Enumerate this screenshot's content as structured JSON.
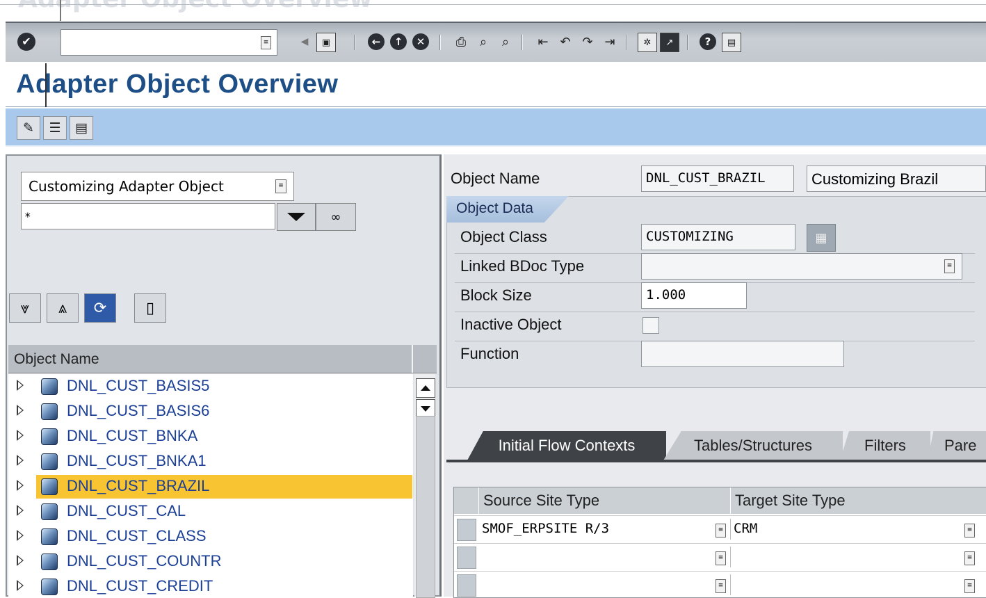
{
  "window": {
    "ghost_title": "Adapter Object Overview"
  },
  "toolbar": {
    "command_value": "",
    "icons": [
      "enter-icon",
      "save-icon",
      "back-icon",
      "exit-icon",
      "cancel-icon",
      "print-icon",
      "find-icon",
      "find-next-icon",
      "first-page-icon",
      "previous-page-icon",
      "next-page-icon",
      "last-page-icon",
      "create-session-icon",
      "shortcut-icon",
      "help-icon",
      "layout-menu-icon"
    ]
  },
  "title": {
    "text": "Adapter Object Overview"
  },
  "app_toolbar": {
    "buttons": [
      "edit-icon",
      "print-list-icon",
      "display-list-icon"
    ]
  },
  "left_panel": {
    "selector_label": "Customizing Adapter Object",
    "pattern_value": "*",
    "tree_toolbar": [
      "expand-all-icon",
      "collapse-all-icon",
      "refresh-icon",
      "new-object-icon"
    ],
    "column_header": "Object Name",
    "items": [
      {
        "label": "DNL_CUST_BASIS5"
      },
      {
        "label": "DNL_CUST_BASIS6"
      },
      {
        "label": "DNL_CUST_BNKA"
      },
      {
        "label": "DNL_CUST_BNKA1"
      },
      {
        "label": "DNL_CUST_BRAZIL",
        "selected": true
      },
      {
        "label": "DNL_CUST_CAL"
      },
      {
        "label": "DNL_CUST_CLASS"
      },
      {
        "label": "DNL_CUST_COUNTR"
      },
      {
        "label": "DNL_CUST_CREDIT"
      }
    ],
    "selected_color": "#f8c431"
  },
  "right_panel": {
    "object_name_label": "Object Name",
    "object_name_value": "DNL_CUST_BRAZIL",
    "object_desc_value": "Customizing Brazil",
    "group_tab": "Object Data",
    "fields": {
      "object_class_label": "Object Class",
      "object_class_value": "CUSTOMIZING",
      "linked_bdoc_label": "Linked BDoc Type",
      "linked_bdoc_value": "",
      "block_size_label": "Block Size",
      "block_size_value": "1.000",
      "inactive_label": "Inactive Object",
      "inactive_checked": false,
      "function_label": "Function",
      "function_value": ""
    },
    "tabs": [
      "Initial Flow Contexts",
      "Tables/Structures",
      "Filters",
      "Pare"
    ],
    "active_tab": "Initial Flow Contexts",
    "table": {
      "columns": [
        "Source Site Type",
        "Target Site Type"
      ],
      "rows": [
        {
          "source": "SMOF_ERPSITE R/3",
          "target": "CRM"
        },
        {
          "source": "",
          "target": ""
        },
        {
          "source": "",
          "target": ""
        }
      ]
    }
  },
  "colors": {
    "title_blue": "#1e4e86",
    "app_toolbar_bg": "#a8c8ec",
    "tree_link": "#1b3f95"
  }
}
